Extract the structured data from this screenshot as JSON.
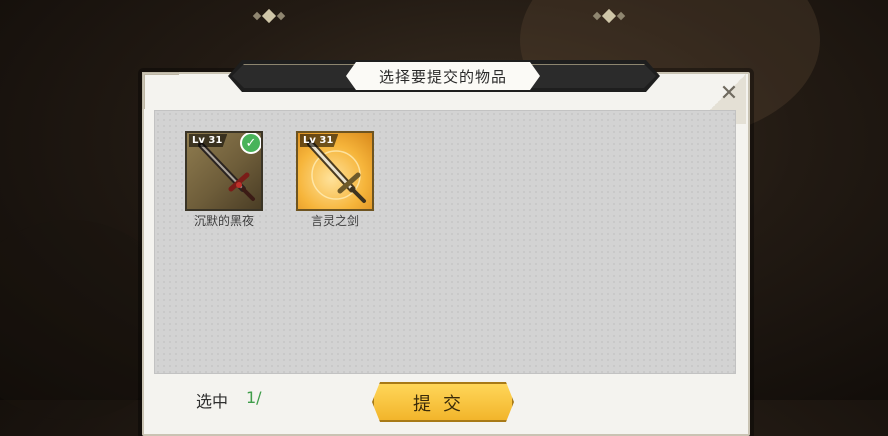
{
  "dialog": {
    "title": "选择要提交的物品",
    "close_icon": "close-icon"
  },
  "items": [
    {
      "level": "Lv 31",
      "name": "沉默的黑夜",
      "selected": true,
      "rarity": "normal",
      "icon": "dark-sword-icon"
    },
    {
      "level": "Lv 31",
      "name": "言灵之剑",
      "selected": false,
      "rarity": "gold",
      "icon": "spirit-sword-icon"
    }
  ],
  "footer": {
    "selected_label": "选中",
    "selected_count": "1/",
    "submit_label": "提交"
  },
  "colors": {
    "selected_check": "#48b35a",
    "submit_button": "#f6c23e",
    "gold_frame": "#f6b53b"
  }
}
